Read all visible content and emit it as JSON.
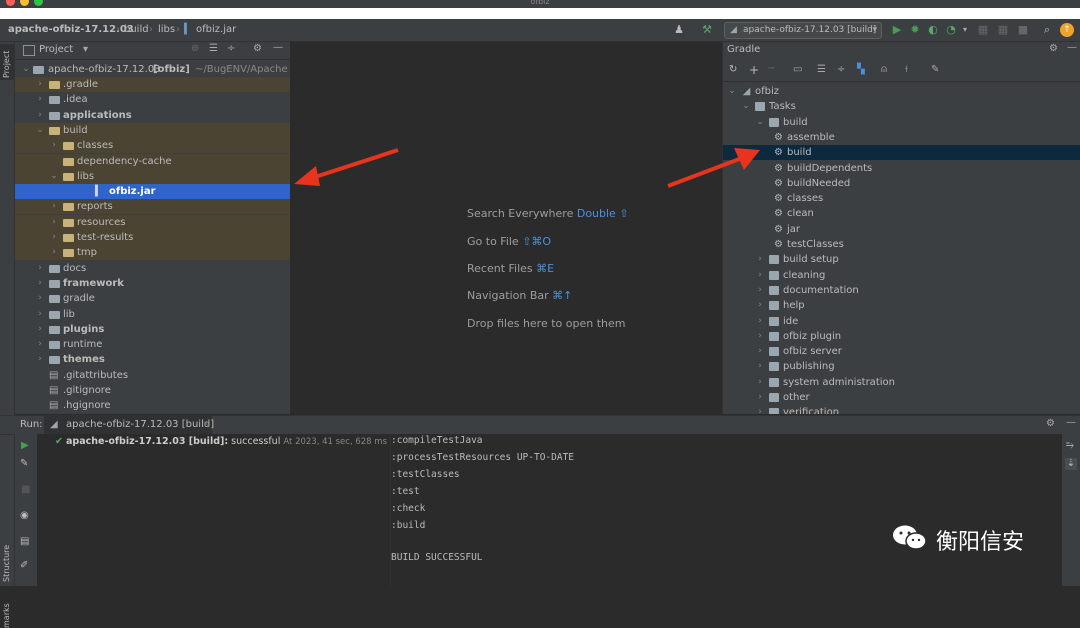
{
  "window": {
    "title": "ofbiz"
  },
  "navbar": {
    "crumbs": [
      "apache-ofbiz-17.12.03",
      "build",
      "libs",
      "ofbiz.jar"
    ],
    "run_config": "apache-ofbiz-17.12.03 [build]"
  },
  "stripes": {
    "project": "Project",
    "structure": "Structure",
    "bookmarks": "marks"
  },
  "project": {
    "header": "Project",
    "root": {
      "name": "apache-ofbiz-17.12.03",
      "module": "[ofbiz]",
      "path": "~/BugENV/Apache OF"
    },
    "rows": [
      {
        "label": ".gradle",
        "indent": 1,
        "arrow": ">",
        "kind": "ex"
      },
      {
        "label": ".idea",
        "indent": 1,
        "arrow": ">",
        "kind": "plain"
      },
      {
        "label": "applications",
        "indent": 1,
        "arrow": ">",
        "kind": "mod"
      },
      {
        "label": "build",
        "indent": 1,
        "arrow": "v",
        "kind": "ex"
      },
      {
        "label": "classes",
        "indent": 2,
        "arrow": ">",
        "kind": "ex"
      },
      {
        "label": "dependency-cache",
        "indent": 2,
        "arrow": "",
        "kind": "ex"
      },
      {
        "label": "libs",
        "indent": 2,
        "arrow": "v",
        "kind": "ex"
      },
      {
        "label": "ofbiz.jar",
        "indent": 3,
        "arrow": "",
        "kind": "jar"
      },
      {
        "label": "reports",
        "indent": 2,
        "arrow": ">",
        "kind": "ex"
      },
      {
        "label": "resources",
        "indent": 2,
        "arrow": ">",
        "kind": "ex"
      },
      {
        "label": "test-results",
        "indent": 2,
        "arrow": ">",
        "kind": "ex"
      },
      {
        "label": "tmp",
        "indent": 2,
        "arrow": ">",
        "kind": "ex"
      },
      {
        "label": "docs",
        "indent": 1,
        "arrow": ">",
        "kind": "plain"
      },
      {
        "label": "framework",
        "indent": 1,
        "arrow": ">",
        "kind": "mod"
      },
      {
        "label": "gradle",
        "indent": 1,
        "arrow": ">",
        "kind": "plain"
      },
      {
        "label": "lib",
        "indent": 1,
        "arrow": ">",
        "kind": "plain"
      },
      {
        "label": "plugins",
        "indent": 1,
        "arrow": ">",
        "kind": "mod"
      },
      {
        "label": "runtime",
        "indent": 1,
        "arrow": ">",
        "kind": "plain"
      },
      {
        "label": "themes",
        "indent": 1,
        "arrow": ">",
        "kind": "mod"
      },
      {
        "label": ".gitattributes",
        "indent": 1,
        "arrow": "",
        "kind": "file"
      },
      {
        "label": ".gitignore",
        "indent": 1,
        "arrow": "",
        "kind": "file"
      },
      {
        "label": ".hgignore",
        "indent": 1,
        "arrow": "",
        "kind": "file"
      }
    ]
  },
  "editor": {
    "hints": [
      {
        "text": "Search Everywhere",
        "key": "Double ⇧"
      },
      {
        "text": "Go to File",
        "key": "⇧⌘O"
      },
      {
        "text": "Recent Files",
        "key": "⌘E"
      },
      {
        "text": "Navigation Bar",
        "key": "⌘↑"
      },
      {
        "text": "Drop files here to open them",
        "key": ""
      }
    ]
  },
  "gradle": {
    "header": "Gradle",
    "rows": [
      {
        "label": "ofbiz",
        "indent": 0,
        "arrow": "v",
        "kind": "project"
      },
      {
        "label": "Tasks",
        "indent": 1,
        "arrow": "v",
        "kind": "folder"
      },
      {
        "label": "build",
        "indent": 2,
        "arrow": "v",
        "kind": "folder"
      },
      {
        "label": "assemble",
        "indent": 3,
        "arrow": "",
        "kind": "task"
      },
      {
        "label": "build",
        "indent": 3,
        "arrow": "",
        "kind": "task"
      },
      {
        "label": "buildDependents",
        "indent": 3,
        "arrow": "",
        "kind": "task"
      },
      {
        "label": "buildNeeded",
        "indent": 3,
        "arrow": "",
        "kind": "task"
      },
      {
        "label": "classes",
        "indent": 3,
        "arrow": "",
        "kind": "task"
      },
      {
        "label": "clean",
        "indent": 3,
        "arrow": "",
        "kind": "task"
      },
      {
        "label": "jar",
        "indent": 3,
        "arrow": "",
        "kind": "task"
      },
      {
        "label": "testClasses",
        "indent": 3,
        "arrow": "",
        "kind": "task"
      },
      {
        "label": "build setup",
        "indent": 2,
        "arrow": ">",
        "kind": "folder"
      },
      {
        "label": "cleaning",
        "indent": 2,
        "arrow": ">",
        "kind": "folder"
      },
      {
        "label": "documentation",
        "indent": 2,
        "arrow": ">",
        "kind": "folder"
      },
      {
        "label": "help",
        "indent": 2,
        "arrow": ">",
        "kind": "folder"
      },
      {
        "label": "ide",
        "indent": 2,
        "arrow": ">",
        "kind": "folder"
      },
      {
        "label": "ofbiz plugin",
        "indent": 2,
        "arrow": ">",
        "kind": "folder"
      },
      {
        "label": "ofbiz server",
        "indent": 2,
        "arrow": ">",
        "kind": "folder"
      },
      {
        "label": "publishing",
        "indent": 2,
        "arrow": ">",
        "kind": "folder"
      },
      {
        "label": "system administration",
        "indent": 2,
        "arrow": ">",
        "kind": "folder"
      },
      {
        "label": "other",
        "indent": 2,
        "arrow": ">",
        "kind": "folder"
      },
      {
        "label": "verification",
        "indent": 2,
        "arrow": ">",
        "kind": "folder"
      }
    ]
  },
  "run": {
    "label": "Run:",
    "tab": "apache-ofbiz-17.12.03 [build]",
    "result_name": "apache-ofbiz-17.12.03 [build]:",
    "result_status": "successful",
    "result_time": "At 2023, 41 sec, 628 ms",
    "console": [
      ":compileTestJava",
      ":processTestResources UP-TO-DATE",
      ":testClasses",
      ":test",
      ":check",
      ":build",
      "",
      "BUILD SUCCESSFUL"
    ]
  },
  "watermark": {
    "text": "衡阳信安"
  },
  "colors": {
    "accent": "#2f65ca",
    "arrow": "#e8341c",
    "success": "#59a869",
    "run": "#499c54"
  }
}
